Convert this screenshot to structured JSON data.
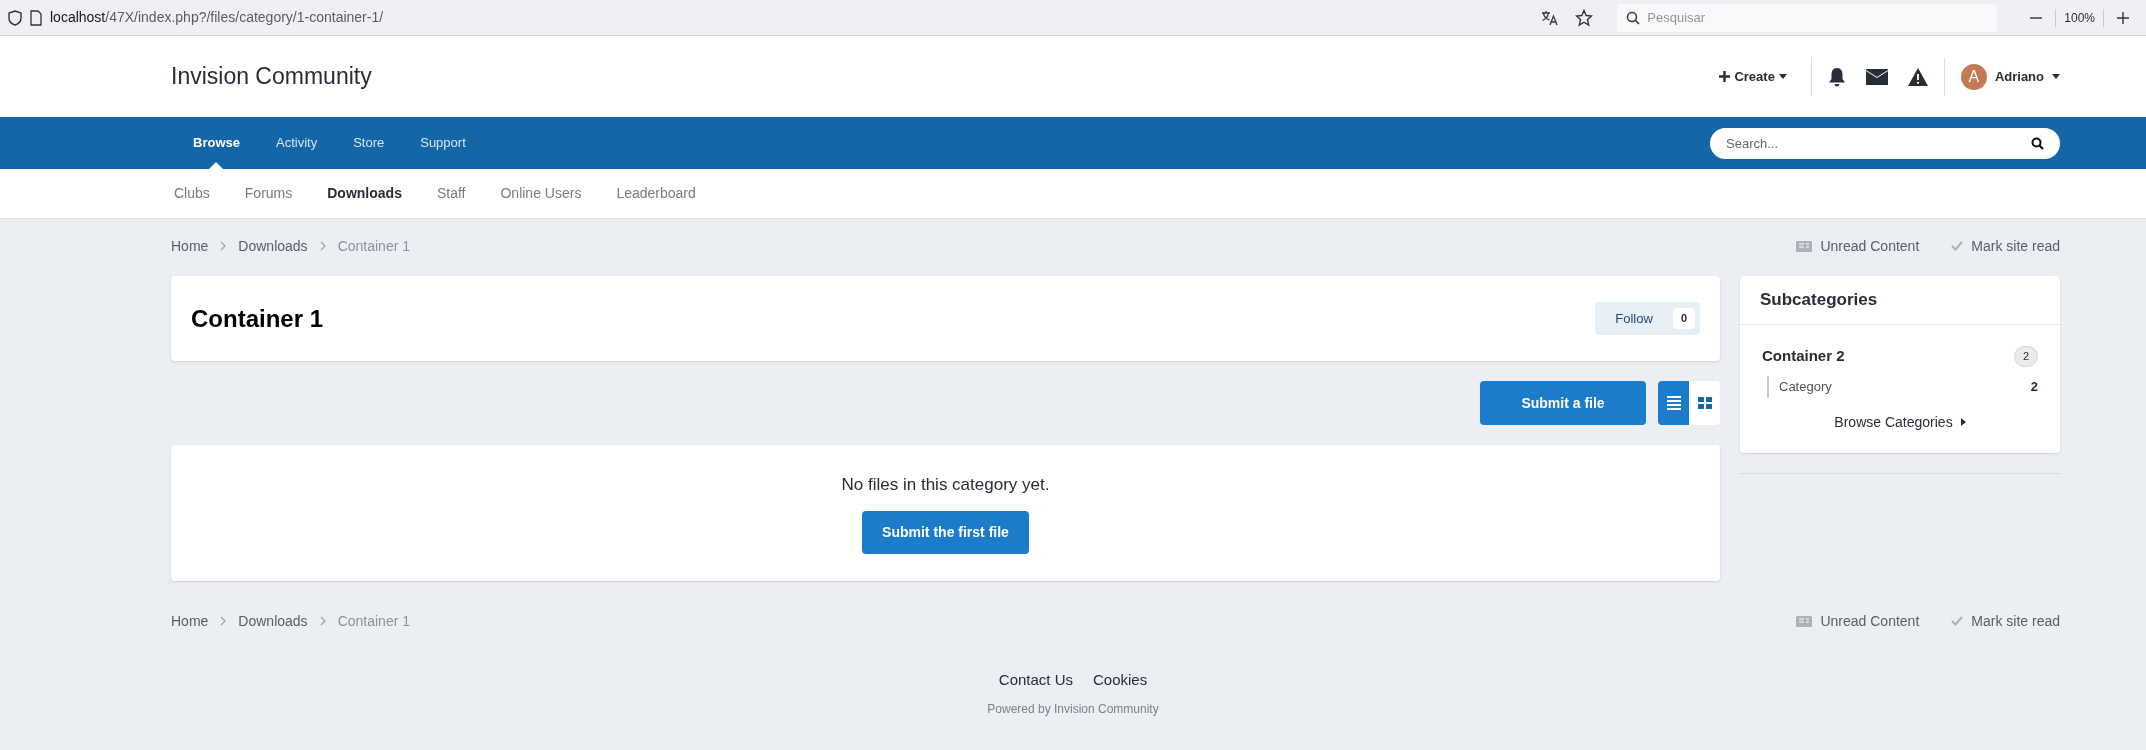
{
  "browser": {
    "url_host": "localhost",
    "url_path": "/47X/index.php?/files/category/1-container-1/",
    "search_placeholder": "Pesquisar",
    "zoom": "100%"
  },
  "header": {
    "logo": "Invision Community",
    "create": "Create",
    "user": {
      "initial": "A",
      "name": "Adriano"
    }
  },
  "nav": [
    {
      "label": "Browse",
      "selected": true
    },
    {
      "label": "Activity",
      "selected": false
    },
    {
      "label": "Store",
      "selected": false
    },
    {
      "label": "Support",
      "selected": false
    }
  ],
  "nav_search": {
    "placeholder": "Search..."
  },
  "subnav": [
    {
      "label": "Clubs",
      "selected": false
    },
    {
      "label": "Forums",
      "selected": false
    },
    {
      "label": "Downloads",
      "selected": true
    },
    {
      "label": "Staff",
      "selected": false
    },
    {
      "label": "Online Users",
      "selected": false
    },
    {
      "label": "Leaderboard",
      "selected": false
    }
  ],
  "breadcrumbs_top": {
    "items": [
      "Home",
      "Downloads",
      "Container 1"
    ],
    "actions": [
      "Unread Content",
      "Mark site read"
    ]
  },
  "page": {
    "title": "Container 1",
    "follow": "Follow",
    "follow_count": "0",
    "submit": "Submit a file",
    "view_modes": [
      {
        "kind": "list",
        "selected": true
      },
      {
        "kind": "grid",
        "selected": false
      }
    ]
  },
  "empty": {
    "message": "No files in this category yet.",
    "button": "Submit the first file"
  },
  "sidebar": {
    "title": "Subcategories",
    "categories": [
      {
        "name": "Container 2",
        "count": "2",
        "children": [
          {
            "name": "Category",
            "count": "2"
          }
        ]
      }
    ],
    "browse": "Browse Categories"
  },
  "breadcrumbs_bottom": {
    "items": [
      "Home",
      "Downloads",
      "Container 1"
    ],
    "actions": [
      "Unread Content",
      "Mark site read"
    ]
  },
  "footer": {
    "links": [
      "Contact Us",
      "Cookies"
    ],
    "powered": "Powered by Invision Community"
  }
}
